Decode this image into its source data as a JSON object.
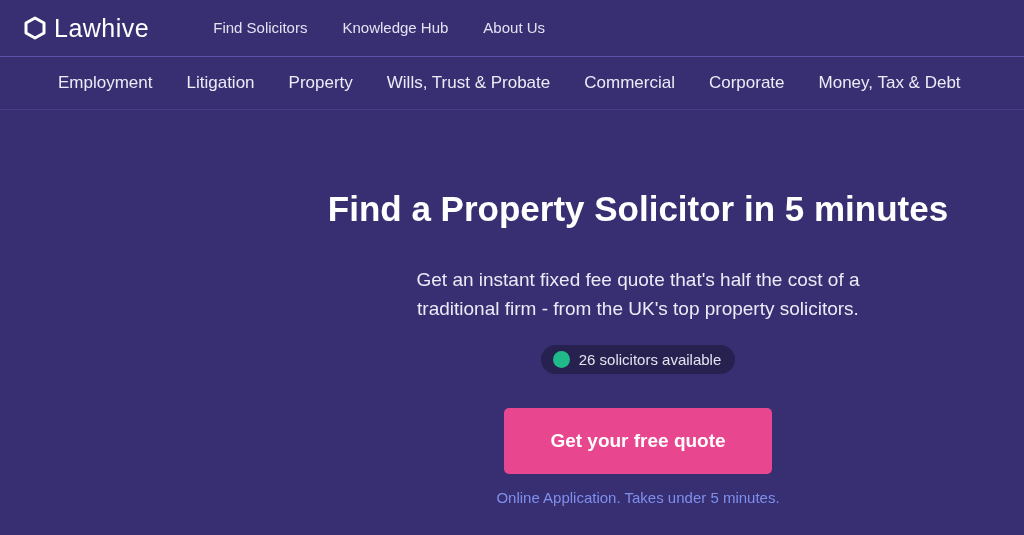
{
  "header": {
    "logo": "Lawhive",
    "links": [
      "Find Solicitors",
      "Knowledge Hub",
      "About Us"
    ]
  },
  "categories": [
    "Employment",
    "Litigation",
    "Property",
    "Wills, Trust & Probate",
    "Commercial",
    "Corporate",
    "Money, Tax & Debt"
  ],
  "hero": {
    "title": "Find a Property Solicitor in 5 minutes",
    "subtitle": "Get an instant fixed fee quote that's half the cost of a traditional firm - from the UK's top property solicitors.",
    "availability": {
      "text": "26 solicitors available",
      "color": "#20b98a"
    },
    "button": "Get your free quote",
    "note": "Online Application. Takes under 5 minutes."
  }
}
